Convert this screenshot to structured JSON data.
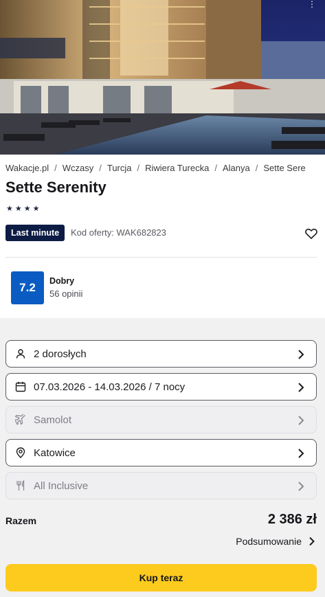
{
  "hero": {
    "image_alt": "hotel-pool-night-photo",
    "menu_icon": "more-vertical-icon"
  },
  "breadcrumb": [
    "Wakacje.pl",
    "Wczasy",
    "Turcja",
    "Riwiera Turecka",
    "Alanya",
    "Sette Sere"
  ],
  "hotel": {
    "name": "Sette Serenity",
    "stars": 4,
    "badge": "Last minute",
    "offer_code": "Kod oferty: WAK682823"
  },
  "rating": {
    "score": "7.2",
    "label": "Dobry",
    "reviews": "56 opinii"
  },
  "options": [
    {
      "label": "2 dorosłych",
      "icon": "person-icon",
      "disabled": false
    },
    {
      "label": "07.03.2026 - 14.03.2026 / 7 nocy",
      "icon": "calendar-icon",
      "disabled": false
    },
    {
      "label": "Samolot",
      "icon": "plane-icon",
      "disabled": true
    },
    {
      "label": "Katowice",
      "icon": "location-pin-icon",
      "disabled": false
    },
    {
      "label": "All Inclusive",
      "icon": "cutlery-icon",
      "disabled": true
    }
  ],
  "summary": {
    "total_label": "Razem",
    "total_value": "2 386 zł",
    "summary_link": "Podsumowanie",
    "buy_label": "Kup teraz"
  },
  "colors": {
    "badge": "#0c1c44",
    "rating": "#0a5cc2",
    "buy": "#fccb1e"
  }
}
